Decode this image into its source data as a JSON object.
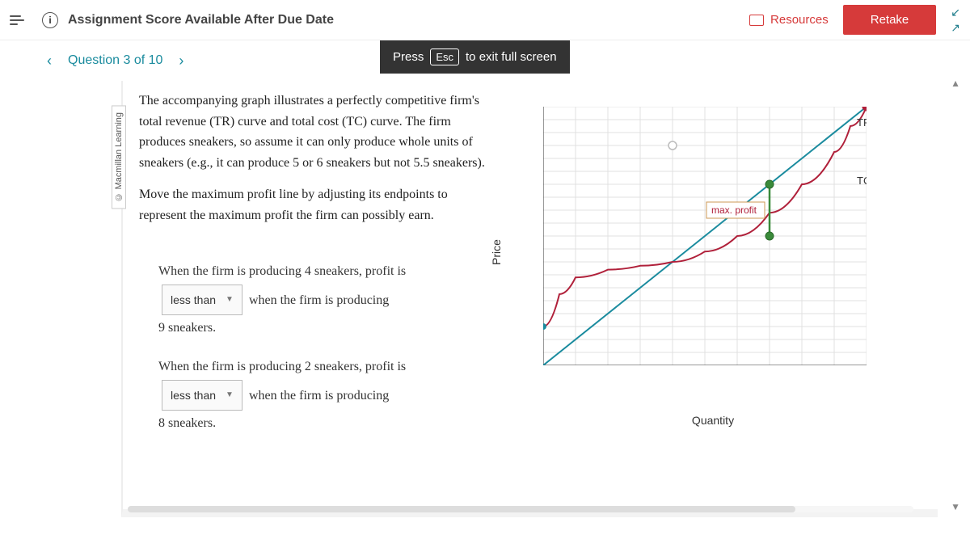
{
  "topbar": {
    "info_glyph": "i",
    "title": "Assignment Score Available After Due Date",
    "resources_label": "Resources",
    "retake_label": "Retake"
  },
  "esc_banner": {
    "prefix": "Press",
    "key": "Esc",
    "suffix": "to exit full screen"
  },
  "nav": {
    "label": "Question 3 of 10"
  },
  "copyright": "© Macmillan Learning",
  "prompt": {
    "paragraph": "The accompanying graph illustrates a perfectly competitive firm's total revenue (TR) curve and total cost (TC) curve. The firm produces sneakers, so assume it can only produce whole units of sneakers (e.g., it can produce 5 or 6 sneakers but not 5.5 sneakers).",
    "instruction": "Move the maximum profit line by adjusting its endpoints to represent the maximum profit the firm can possibly earn."
  },
  "subq": {
    "q1_pre": "When the firm is producing 4 sneakers, profit is",
    "q1_dropdown": "less than",
    "q1_post": "when the firm is producing",
    "q1_end": "9 sneakers.",
    "q2_pre": "When the firm is producing 2 sneakers, profit is",
    "q2_dropdown": "less than",
    "q2_post": "when the firm is producing",
    "q2_end": "8 sneakers."
  },
  "chart_data": {
    "type": "line",
    "xlabel": "Quantity",
    "ylabel": "Price",
    "x_ticks": [
      0,
      1,
      2,
      3,
      4,
      5,
      6,
      7,
      8,
      9,
      10
    ],
    "y_ticks": [
      0,
      1,
      2,
      3,
      4,
      5,
      6,
      7,
      8,
      9,
      10,
      11,
      12,
      13,
      14,
      15,
      16,
      17,
      18,
      19,
      20
    ],
    "xlim": [
      0,
      10
    ],
    "ylim": [
      0,
      20
    ],
    "series": [
      {
        "name": "TR",
        "color": "#1a8b9e",
        "points": [
          [
            0,
            0
          ],
          [
            10,
            20
          ]
        ]
      },
      {
        "name": "TC",
        "color": "#b0203a",
        "points": [
          [
            0,
            3
          ],
          [
            0.5,
            5.5
          ],
          [
            1,
            6.8
          ],
          [
            2,
            7.4
          ],
          [
            3,
            7.7
          ],
          [
            4,
            8.0
          ],
          [
            5,
            8.8
          ],
          [
            6,
            10.0
          ],
          [
            7,
            11.8
          ],
          [
            8,
            14.0
          ],
          [
            9,
            16.5
          ],
          [
            9.5,
            18.5
          ],
          [
            10,
            20
          ]
        ]
      }
    ],
    "annotations": {
      "tr_label": "TR",
      "tc_label": "TC",
      "max_profit_label": "max. profit",
      "profit_line": {
        "x": 7,
        "y_top": 14,
        "y_bot": 10
      },
      "hollow_marker": {
        "x": 4,
        "y": 17
      }
    }
  }
}
